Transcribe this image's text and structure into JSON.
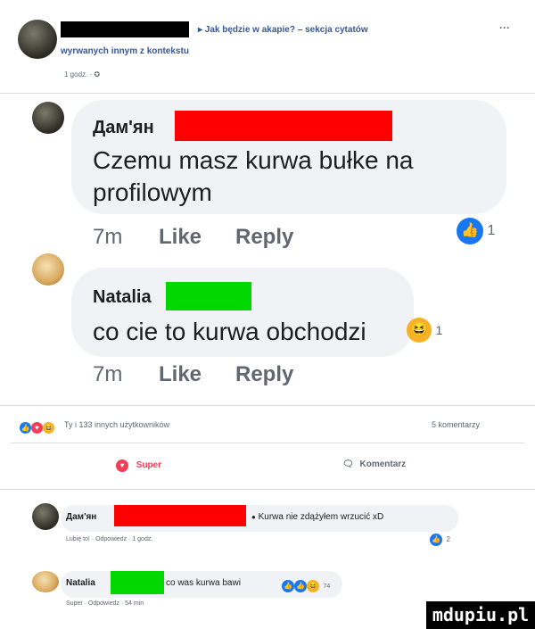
{
  "post": {
    "header_text": "▸ Jak będzie w akapie? – sekcja cytatów",
    "header_text2": "wyrwanych innym z kontekstu",
    "time": "1 godz. · ✪",
    "more": "···"
  },
  "comment1": {
    "author": "Дам'ян",
    "text_line1": "Czemu masz kurwa bułke na",
    "text_line2": "profilowym",
    "time": "7m",
    "like": "Like",
    "reply": "Reply",
    "reaction_count": "1"
  },
  "comment2": {
    "author": "Natalia",
    "text": "co cie to kurwa obchodzi",
    "reaction_count": "1",
    "time": "7m",
    "like": "Like",
    "reply": "Reply"
  },
  "stats": {
    "reactions_text": "Ty i 133 innych użytkowników",
    "comments_count": "5 komentarzy"
  },
  "actions": {
    "super": "Super",
    "comment": "Komentarz"
  },
  "reply1": {
    "author": "Дам'ян",
    "text": "Kurwa nie zdążyłem wrzucić xD",
    "meta": "Lubię to! · Odpowiedz · 1 godz.",
    "reaction_count": "2"
  },
  "reply2": {
    "author": "Natalia",
    "text": "co was kurwa bawi",
    "reaction_count": "74",
    "meta": "Super · Odpowiedz · 54 min"
  },
  "watermark": "mdupiu.pl",
  "colors": {
    "fb_blue": "#1877f2",
    "link_blue": "#385898",
    "bubble": "#f0f2f5",
    "redact_red": "#ff0000",
    "redact_green": "#00d800"
  }
}
